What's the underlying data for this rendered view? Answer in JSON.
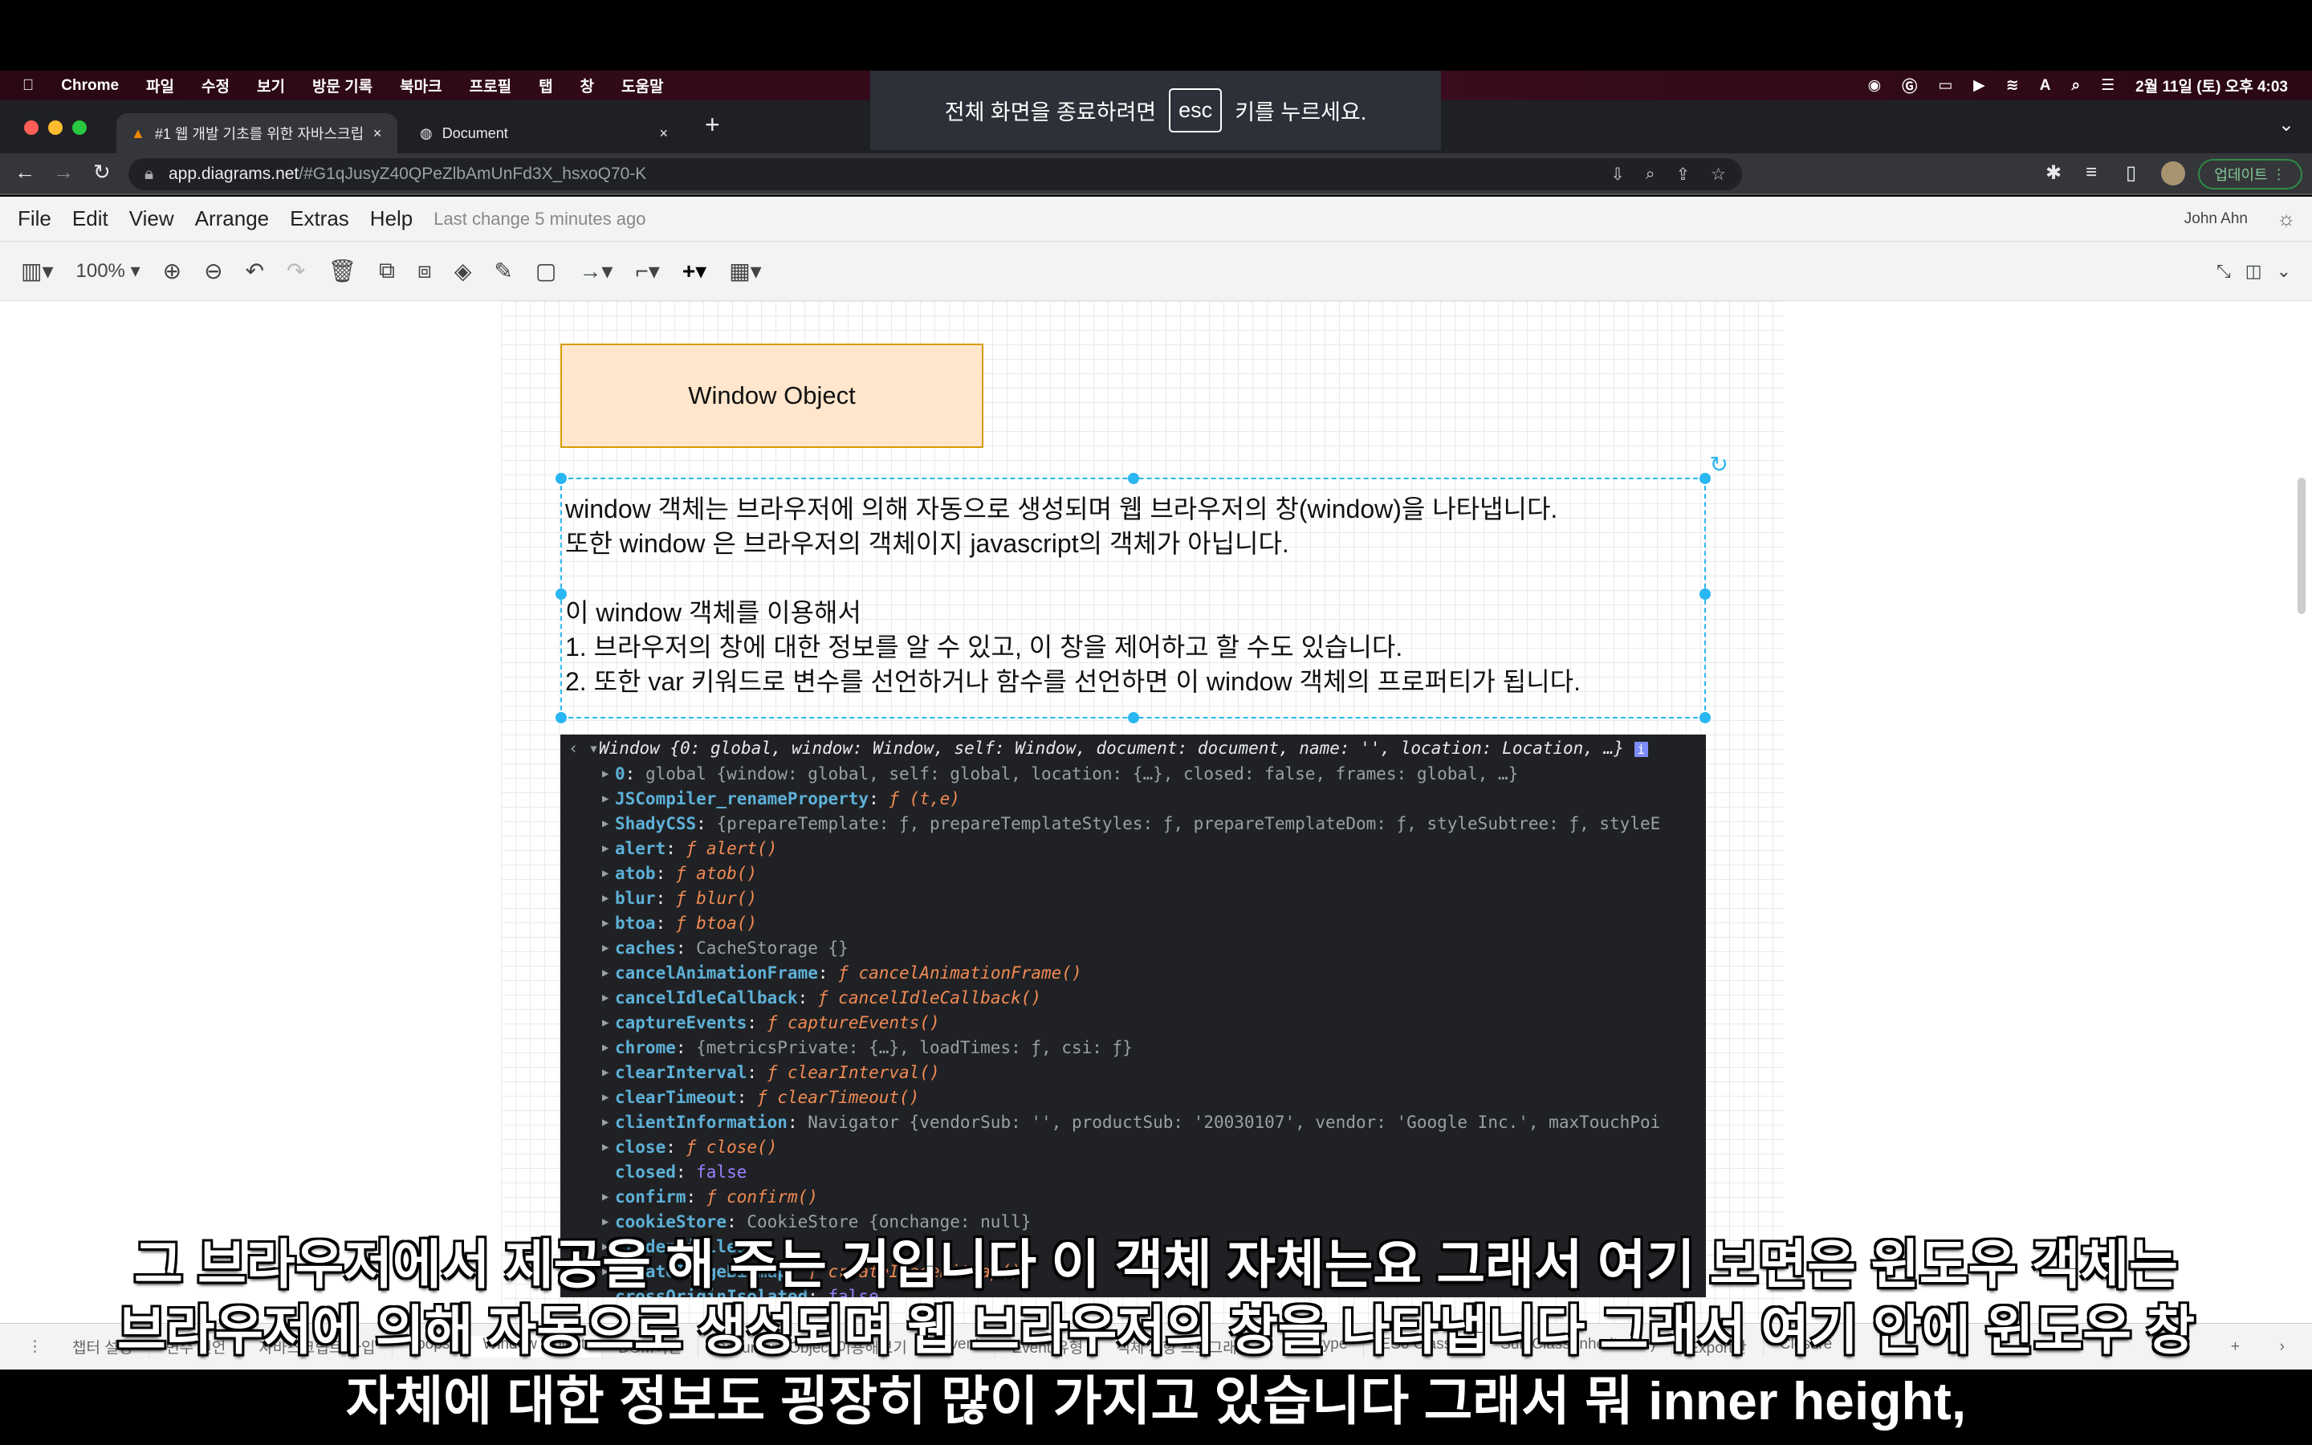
{
  "menubar": {
    "apple": "",
    "app": "Chrome",
    "items": [
      "파일",
      "수정",
      "보기",
      "방문 기록",
      "북마크",
      "프로필",
      "탭",
      "창",
      "도움말"
    ],
    "clock": "2월 11일 (토) 오후 4:03"
  },
  "tabs": [
    {
      "title": "#1 웹 개발 기초를 위한 자바스크립트",
      "active": true
    },
    {
      "title": "Document",
      "active": false
    }
  ],
  "address": {
    "host": "app.diagrams.net",
    "path": "/#G1qJusyZ40QPeZlbAmUnFd3X_hsxoQ70-K",
    "update_button": "업데이트"
  },
  "fullscreen_notice": {
    "before": "전체 화면을 종료하려면",
    "key": "esc",
    "after": "키를 누르세요."
  },
  "drawio": {
    "menu": [
      "File",
      "Edit",
      "View",
      "Arrange",
      "Extras",
      "Help"
    ],
    "last_change": "Last change 5 minutes ago",
    "user": "John Ahn",
    "zoom": "100%"
  },
  "diagram": {
    "title_box": "Window Object",
    "text_lines": [
      "window 객체는 브라우저에 의해 자동으로 생성되며 웹 브라우저의 창(window)을 나타냅니다.",
      "또한 window 은 브라우저의 객체이지 javascript의 객체가 아닙니다.",
      "",
      "이 window 객체를 이용해서",
      "1. 브라우저의 창에 대한 정보를 알 수 있고, 이 창을 제어하고 할 수도 있습니다.",
      "2. 또한 var 키워드로 변수를 선언하거나 함수를 선언하면 이 window 객체의 프로퍼티가 됩니다."
    ]
  },
  "console": {
    "header": "Window {0: global, window: Window, self: Window, document: document, name: '', location: Location, …}",
    "rows": [
      {
        "key": "0",
        "val": "global {window: global, self: global, location: {…}, closed: false, frames: global, …}",
        "type": "obj"
      },
      {
        "key": "JSCompiler_renameProperty",
        "val": "(t,e)",
        "type": "fn"
      },
      {
        "key": "ShadyCSS",
        "val": "{prepareTemplate: ƒ, prepareTemplateStyles: ƒ, prepareTemplateDom: ƒ, styleSubtree: ƒ, styleE",
        "type": "obj"
      },
      {
        "key": "alert",
        "val": "alert()",
        "type": "fn"
      },
      {
        "key": "atob",
        "val": "atob()",
        "type": "fn"
      },
      {
        "key": "blur",
        "val": "blur()",
        "type": "fn"
      },
      {
        "key": "btoa",
        "val": "btoa()",
        "type": "fn"
      },
      {
        "key": "caches",
        "val": "CacheStorage {}",
        "type": "obj"
      },
      {
        "key": "cancelAnimationFrame",
        "val": "cancelAnimationFrame()",
        "type": "fn"
      },
      {
        "key": "cancelIdleCallback",
        "val": "cancelIdleCallback()",
        "type": "fn"
      },
      {
        "key": "captureEvents",
        "val": "captureEvents()",
        "type": "fn"
      },
      {
        "key": "chrome",
        "val": "{metricsPrivate: {…}, loadTimes: ƒ, csi: ƒ}",
        "type": "obj"
      },
      {
        "key": "clearInterval",
        "val": "clearInterval()",
        "type": "fn"
      },
      {
        "key": "clearTimeout",
        "val": "clearTimeout()",
        "type": "fn"
      },
      {
        "key": "clientInformation",
        "val": "Navigator {vendorSub: '', productSub: '20030107', vendor: 'Google Inc.', maxTouchPoi",
        "type": "obj"
      },
      {
        "key": "close",
        "val": "close()",
        "type": "fn"
      },
      {
        "key": "closed",
        "val": "false",
        "type": "bool"
      },
      {
        "key": "confirm",
        "val": "confirm()",
        "type": "fn"
      },
      {
        "key": "cookieStore",
        "val": "CookieStore {onchange: null}",
        "type": "obj"
      },
      {
        "key": "credentialless",
        "val": "",
        "type": "obj"
      },
      {
        "key": "createImageBitmap",
        "val": "createImageBitmap()",
        "type": "fn"
      },
      {
        "key": "crossOriginIsolated",
        "val": "false",
        "type": "bool"
      }
    ]
  },
  "page_tabs": [
    "챕터 설명",
    "변수 선언",
    "자바스크립트 타입",
    "Loops",
    "Window Object",
    "DOM이란",
    "Document Object 이용해보기",
    "Event",
    "Event 유형",
    "객체 지향 프로그래밍",
    "prototype",
    "ES6 Classes",
    "Sub Class(Inheritance)",
    "Export란",
    "Closure"
  ],
  "active_page": "Window Object",
  "subtitles": [
    "그 브라우저에서 제공을 해 주는 거입니다 이 객체 자체는요 그래서 여기 보면은 윈도우 객체는",
    "브라우저에 의해 자동으로 생성되며 웹 브라우저의 창을 나타냅니다 그래서 여기 안에 윈도우 창",
    "자체에 대한 정보도 굉장히 많이 가지고 있습니다 그래서 뭐 inner height,"
  ],
  "colors": {
    "shape_fill": "#ffe6cc",
    "shape_border": "#d79b00",
    "selection": "#29b6f2",
    "console_bg": "#202124"
  }
}
